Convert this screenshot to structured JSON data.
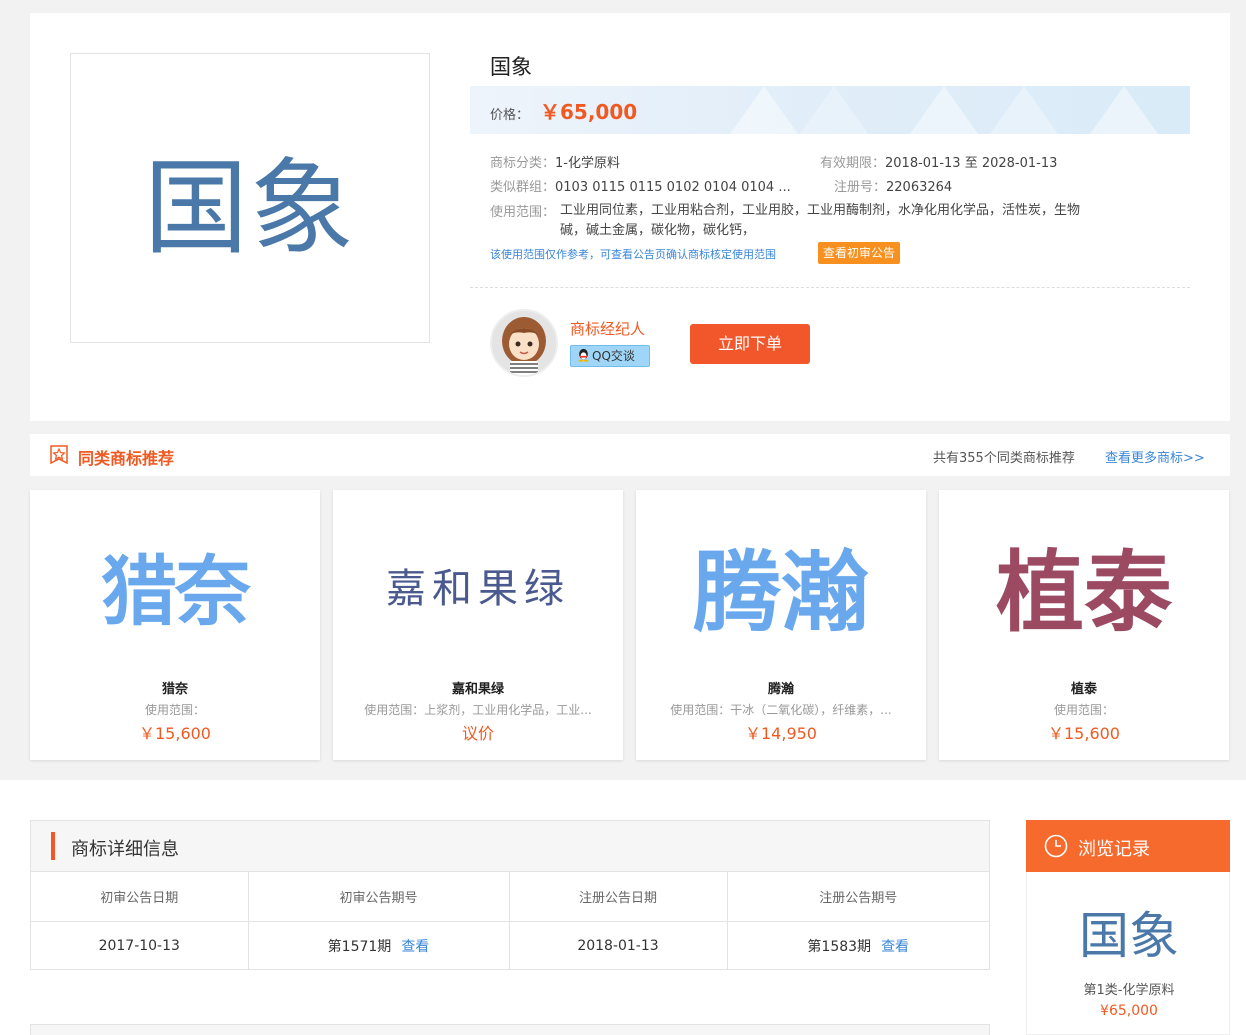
{
  "product": {
    "logo_text": "国象",
    "title": "国象",
    "price_label": "价格：",
    "price": "￥65,000",
    "category_label": "商标分类：",
    "category": "1-化学原料",
    "validity_label": "有效期限：",
    "validity": "2018-01-13 至 2028-01-13",
    "groups_label": "类似群组：",
    "groups": "0103 0115 0115 0102 0104 0104 ...",
    "reg_label": "注册号：",
    "reg_no": "22063264",
    "scope_label": "使用范围：",
    "scope": "工业用同位素，工业用粘合剂，工业用胶，工业用酶制剂，水净化用化学品，活性炭，生物碱，碱土金属，碳化物，碳化钙，",
    "scope_note": "该使用范围仅作参考，可查看公告页确认商标核定使用范围",
    "notice_button": "查看初审公告",
    "agent_name": "商标经纪人",
    "qq_button": "QQ交谈",
    "order_button": "立即下单"
  },
  "recommend": {
    "title": "同类商标推荐",
    "count_text": "共有355个同类商标推荐",
    "more_link": "查看更多商标>>",
    "cards": [
      {
        "mark": "猎奈",
        "name": "猎奈",
        "scope": "使用范围：",
        "price": "￥15,600",
        "color": "#6aa8ee"
      },
      {
        "mark": "嘉和果绿",
        "name": "嘉和果绿",
        "scope": "使用范围：上浆剂，工业用化学品，工业...",
        "price": "议价",
        "color": "#4a5a8e"
      },
      {
        "mark": "腾瀚",
        "name": "腾瀚",
        "scope": "使用范围：干冰（二氧化碳），纤维素，...",
        "price": "￥14,950",
        "color": "#6aa8ee"
      },
      {
        "mark": "植泰",
        "name": "植泰",
        "scope": "使用范围：",
        "price": "￥15,600",
        "color": "#9b4a62"
      }
    ]
  },
  "details": {
    "title": "商标详细信息",
    "headers": [
      "初审公告日期",
      "初审公告期号",
      "注册公告日期",
      "注册公告期号"
    ],
    "row": {
      "prelim_date": "2017-10-13",
      "prelim_issue": "第1571期",
      "reg_date": "2018-01-13",
      "reg_issue": "第1583期",
      "view_link": "查看"
    }
  },
  "history": {
    "title": "浏览记录",
    "mark": "国象",
    "category": "第1类-化学原料",
    "price": "¥65,000"
  }
}
